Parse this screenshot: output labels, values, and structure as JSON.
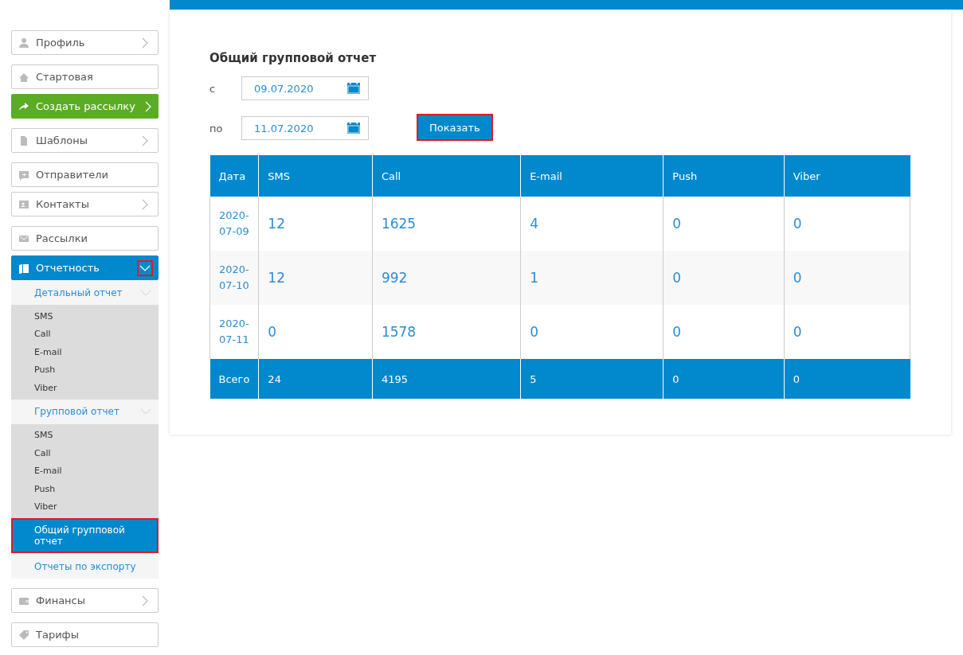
{
  "sidebar": {
    "groups": [
      {
        "items": [
          {
            "label": "Профиль",
            "kind": "plain",
            "chevron": true
          }
        ]
      },
      {
        "items": [
          {
            "label": "Стартовая",
            "kind": "plain",
            "chevron": false
          },
          {
            "label": "Создать рассылку",
            "kind": "accent",
            "chevron": true
          }
        ]
      },
      {
        "items": [
          {
            "label": "Шаблоны",
            "kind": "plain",
            "chevron": true
          }
        ]
      },
      {
        "items": [
          {
            "label": "Отправители",
            "kind": "plain",
            "chevron": false
          },
          {
            "label": "Контакты",
            "kind": "plain",
            "chevron": true
          }
        ]
      },
      {
        "items": [
          {
            "label": "Рассылки",
            "kind": "plain",
            "chevron": false
          },
          {
            "label": "Отчетность",
            "kind": "active",
            "chevron": true,
            "expanded": true,
            "highlighted": true,
            "children": [
              {
                "label": "Детальный отчет",
                "kind": "section",
                "expanded": true,
                "children": [
                  {
                    "label": "SMS"
                  },
                  {
                    "label": "Call"
                  },
                  {
                    "label": "E-mail"
                  },
                  {
                    "label": "Push"
                  },
                  {
                    "label": "Viber"
                  }
                ]
              },
              {
                "label": "Групповой отчет",
                "kind": "section",
                "expanded": true,
                "children": [
                  {
                    "label": "SMS"
                  },
                  {
                    "label": "Call"
                  },
                  {
                    "label": "E-mail"
                  },
                  {
                    "label": "Push"
                  },
                  {
                    "label": "Viber"
                  }
                ]
              },
              {
                "label": "Общий групповой отчет",
                "kind": "link",
                "selected": true,
                "highlighted": true
              },
              {
                "label": "Отчеты по экспорту",
                "kind": "link",
                "selected": false,
                "highlighted": false
              }
            ]
          }
        ]
      },
      {
        "items": [
          {
            "label": "Финансы",
            "kind": "plain",
            "chevron": true
          }
        ]
      },
      {
        "items": [
          {
            "label": "Тарифы",
            "kind": "plain",
            "chevron": false
          }
        ]
      }
    ]
  },
  "report": {
    "title": "Общий групповой отчет",
    "filters": [
      {
        "label": "с",
        "value": "09.07.2020"
      },
      {
        "label": "по",
        "value": "11.07.2020"
      }
    ],
    "submit": {
      "label": "Показать",
      "highlighted": true
    },
    "table": {
      "columns": [
        "Дата",
        "SMS",
        "Call",
        "E-mail",
        "Push",
        "Viber"
      ],
      "rows": [
        [
          "2020-07-09",
          "12",
          "1625",
          "4",
          "0",
          "0"
        ],
        [
          "2020-07-10",
          "12",
          "992",
          "1",
          "0",
          "0"
        ],
        [
          "2020-07-11",
          "0",
          "1578",
          "0",
          "0",
          "0"
        ]
      ],
      "total": [
        "Всего",
        "24",
        "4195",
        "5",
        "0",
        "0"
      ]
    }
  }
}
